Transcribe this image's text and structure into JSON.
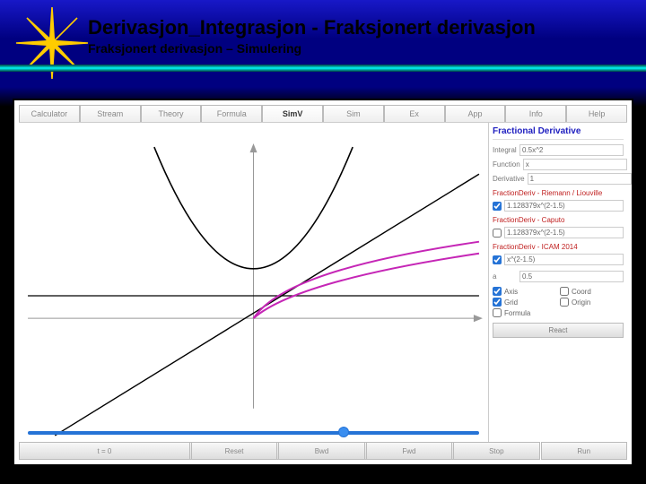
{
  "header": {
    "title": "Derivasjon_Integrasjon  -  Fraksjonert derivasjon",
    "subtitle": "Fraksjonert derivasjon – Simulering"
  },
  "tabs": [
    "Calculator",
    "Stream",
    "Theory",
    "Formula",
    "SimV",
    "Sim",
    "Ex",
    "App",
    "Info",
    "Help"
  ],
  "active_tab": 4,
  "play_controls": [
    ">",
    "|<",
    "<|",
    ">|",
    ">|"
  ],
  "side": {
    "title": "Fractional Derivative",
    "fields": {
      "integral_label": "Integral",
      "integral_value": "0.5x^2",
      "function_label": "Function",
      "function_value": "x",
      "derivative_label": "Derivative",
      "derivative_value": "1"
    },
    "frac_rl_label": "FractionDeriv - Riemann / Liouville",
    "frac_rl_checked": true,
    "frac_rl_value": "1.128379x^(2-1.5)",
    "frac_caputo_label": "FractionDeriv - Caputo",
    "frac_caputo_checked": false,
    "frac_caputo_value": "1.128379x^(2-1.5)",
    "frac_icam_label": "FractionDeriv - ICAM 2014",
    "frac_icam_checked": true,
    "frac_icam_value": "x^(2-1.5)",
    "a_label": "a",
    "a_value": "0.5",
    "toggles": {
      "axis": {
        "label": "Axis",
        "checked": true
      },
      "coord": {
        "label": "Coord",
        "checked": false
      },
      "grid": {
        "label": "Grid",
        "checked": true
      },
      "origin": {
        "label": "Origin",
        "checked": false
      },
      "formula": {
        "label": "Formula",
        "checked": false
      }
    },
    "react_label": "React"
  },
  "bottom": {
    "time_label": "t = 0",
    "buttons": [
      "Reset",
      "Bwd",
      "Fwd",
      "Stop",
      "Run"
    ]
  },
  "chart_data": {
    "type": "line",
    "xlim": [
      -4,
      4
    ],
    "ylim": [
      -3,
      5
    ],
    "title": "",
    "xlabel": "",
    "ylabel": "",
    "axes": true,
    "grid": false,
    "series": [
      {
        "name": "Integral 0.5x^2 (parabola)",
        "color": "#000",
        "formula": "0.5*x^2"
      },
      {
        "name": "Function x (line)",
        "color": "#000",
        "formula": "x"
      },
      {
        "name": "Derivative 1 (horizontal)",
        "color": "#000",
        "formula": "1"
      },
      {
        "name": "FractionDeriv RL 1.1284 x^0.5",
        "color": "#c526b6",
        "formula": "1.1284*x^0.5",
        "domain": "x>=0"
      },
      {
        "name": "FractionDeriv ICAM x^0.5",
        "color": "#c526b6",
        "formula": "x^0.5",
        "domain": "x>=0"
      }
    ]
  }
}
